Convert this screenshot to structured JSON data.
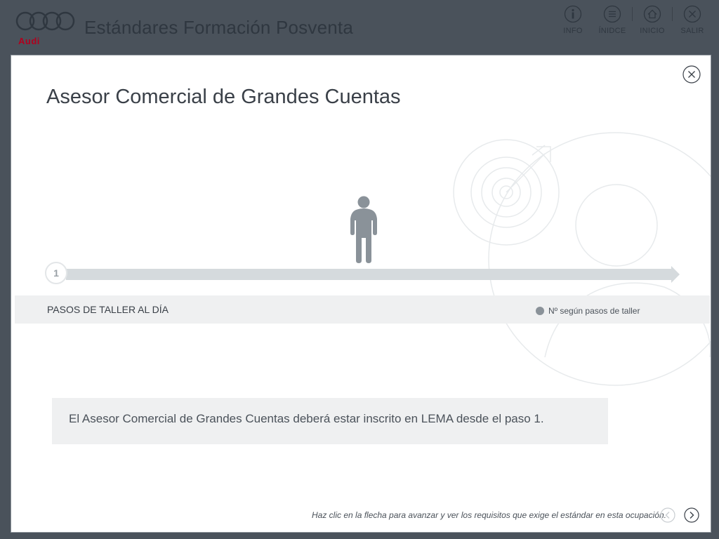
{
  "header": {
    "brand": "Audi",
    "title": "Estándares Formación Posventa",
    "nav": [
      {
        "label": "INFO",
        "icon": "info-icon"
      },
      {
        "label": "ÍNIDCE",
        "icon": "list-icon"
      },
      {
        "label": "INICIO",
        "icon": "home-icon"
      },
      {
        "label": "SALIR",
        "icon": "close-icon"
      }
    ]
  },
  "modal": {
    "title": "Asesor Comercial de Grandes Cuentas",
    "timeline": {
      "step_number": "1"
    },
    "band": {
      "label": "PASOS DE TALLER AL DÍA",
      "legend": "Nº según pasos de taller"
    },
    "info": "El Asesor Comercial de Grandes Cuentas deberá estar inscrito en LEMA desde el paso 1.",
    "footer_hint": "Haz clic en la flecha para avanzar y ver los requisitos que exige el estándar en esta ocupación."
  },
  "colors": {
    "page_background": "#4a525b",
    "brand_red": "#b0001e",
    "band_background": "#eff0f1",
    "track": "#d5dadd",
    "person": "#8a9299"
  }
}
